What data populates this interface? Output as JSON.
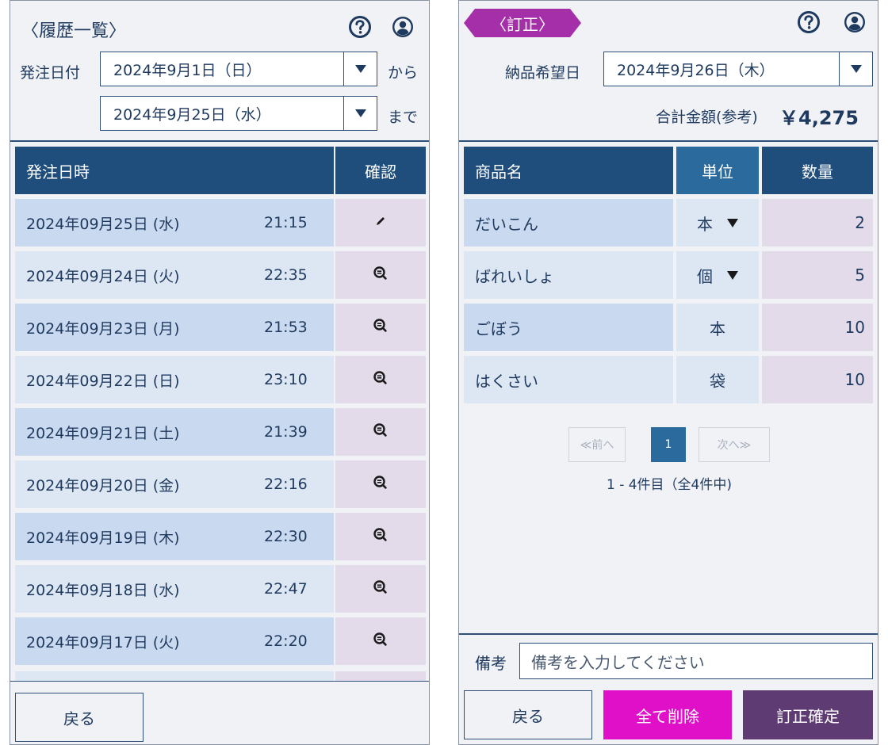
{
  "history": {
    "title": "〈履歴一覧〉",
    "order_date_label": "発注日付",
    "from_date": "2024年9月1日（日）",
    "from_suffix": "から",
    "to_date": "2024年9月25日（水）",
    "to_suffix": "まで",
    "col_datetime": "発注日時",
    "col_confirm": "確認",
    "rows": [
      {
        "date": "2024年09月25日 (水)",
        "time": "21:15",
        "action_icon": "pencil-icon"
      },
      {
        "date": "2024年09月24日 (火)",
        "time": "22:35",
        "action_icon": "magnify-icon"
      },
      {
        "date": "2024年09月23日 (月)",
        "time": "21:53",
        "action_icon": "magnify-icon"
      },
      {
        "date": "2024年09月22日 (日)",
        "time": "23:10",
        "action_icon": "magnify-icon"
      },
      {
        "date": "2024年09月21日 (土)",
        "time": "21:39",
        "action_icon": "magnify-icon"
      },
      {
        "date": "2024年09月20日 (金)",
        "time": "22:16",
        "action_icon": "magnify-icon"
      },
      {
        "date": "2024年09月19日 (木)",
        "time": "22:30",
        "action_icon": "magnify-icon"
      },
      {
        "date": "2024年09月18日 (水)",
        "time": "22:47",
        "action_icon": "magnify-icon"
      },
      {
        "date": "2024年09月17日 (火)",
        "time": "22:20",
        "action_icon": "magnify-icon"
      }
    ],
    "back_label": "戻る"
  },
  "correction": {
    "badge_label": "〈訂正〉",
    "delivery_label": "納品希望日",
    "delivery_date": "2024年9月26日（木）",
    "total_label": "合計金額(参考)",
    "total_value": "￥4,275",
    "col_product": "商品名",
    "col_unit": "単位",
    "col_qty": "数量",
    "items": [
      {
        "name": "だいこん",
        "unit": "本",
        "has_dropdown": true,
        "qty": "2"
      },
      {
        "name": "ばれいしょ",
        "unit": "個",
        "has_dropdown": true,
        "qty": "5"
      },
      {
        "name": "ごぼう",
        "unit": "本",
        "has_dropdown": false,
        "qty": "10"
      },
      {
        "name": "はくさい",
        "unit": "袋",
        "has_dropdown": false,
        "qty": "10"
      }
    ],
    "pagination": {
      "prev": "≪前へ",
      "current": "1",
      "next": "次へ≫",
      "summary": "1 - 4件目（全4件中)"
    },
    "memo_label": "備考",
    "memo_placeholder": "備考を入力してください",
    "back_label": "戻る",
    "delete_all_label": "全て削除",
    "confirm_label": "訂正確定"
  },
  "icons": {
    "help": "help-icon",
    "account": "account-icon"
  },
  "colors": {
    "header_navy": "#1f4e7d",
    "unit_header": "#2b6a9c",
    "badge_purple": "#a52fa8",
    "delete_magenta": "#e010c8",
    "confirm_purple": "#5e3c73",
    "row_blue": "#c9d9ef",
    "row_light": "#dde7f4",
    "cell_lavender": "#e4dbea"
  }
}
